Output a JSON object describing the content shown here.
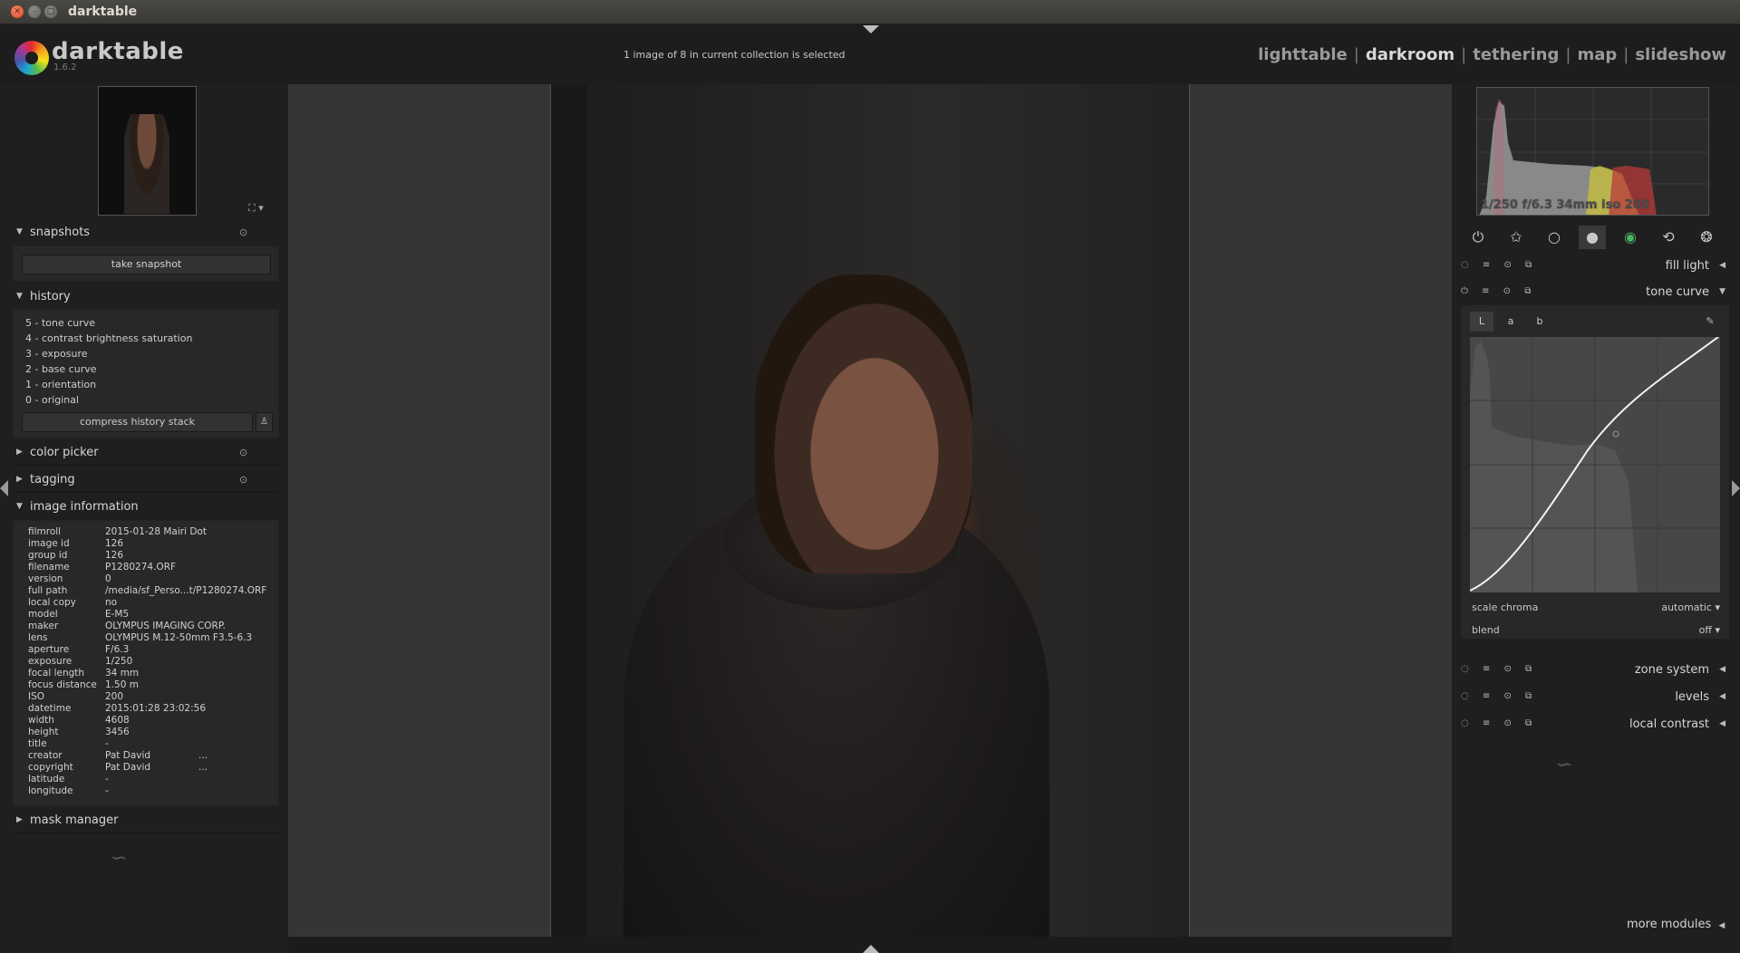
{
  "window": {
    "title": "darktable"
  },
  "app": {
    "name": "darktable",
    "version": "1.6.2"
  },
  "status_text": "1 image of 8 in current collection is selected",
  "views": [
    {
      "label": "lighttable",
      "active": false
    },
    {
      "label": "darkroom",
      "active": true
    },
    {
      "label": "tethering",
      "active": false
    },
    {
      "label": "map",
      "active": false
    },
    {
      "label": "slideshow",
      "active": false
    }
  ],
  "left": {
    "snapshots": {
      "title": "snapshots",
      "button": "take snapshot"
    },
    "history": {
      "title": "history",
      "items": [
        "5 - tone curve",
        "4 - contrast brightness saturation",
        "3 - exposure",
        "2 - base curve",
        "1 - orientation",
        "0 - original"
      ],
      "compress": "compress history stack"
    },
    "color_picker": {
      "title": "color picker"
    },
    "tagging": {
      "title": "tagging"
    },
    "image_information": {
      "title": "image information",
      "rows": [
        {
          "k": "filmroll",
          "v": "2015-01-28 Mairi Dot"
        },
        {
          "k": "image id",
          "v": "126"
        },
        {
          "k": "group id",
          "v": "126"
        },
        {
          "k": "filename",
          "v": "P1280274.ORF"
        },
        {
          "k": "version",
          "v": "0"
        },
        {
          "k": "full path",
          "v": "/media/sf_Perso...t/P1280274.ORF"
        },
        {
          "k": "local copy",
          "v": "no"
        },
        {
          "k": "model",
          "v": "E-M5"
        },
        {
          "k": "maker",
          "v": "OLYMPUS IMAGING CORP."
        },
        {
          "k": "lens",
          "v": "OLYMPUS M.12-50mm F3.5-6.3"
        },
        {
          "k": "aperture",
          "v": "F/6.3"
        },
        {
          "k": "exposure",
          "v": "1/250"
        },
        {
          "k": "focal length",
          "v": "34 mm"
        },
        {
          "k": "focus distance",
          "v": "1.50 m"
        },
        {
          "k": "ISO",
          "v": "200"
        },
        {
          "k": "datetime",
          "v": "2015:01:28 23:02:56"
        },
        {
          "k": "width",
          "v": "4608"
        },
        {
          "k": "height",
          "v": "3456"
        },
        {
          "k": "title",
          "v": "-"
        },
        {
          "k": "creator",
          "v": "Pat David",
          "x": "..."
        },
        {
          "k": "copyright",
          "v": "Pat David",
          "x": "..."
        },
        {
          "k": "latitude",
          "v": "-"
        },
        {
          "k": "longitude",
          "v": "-"
        }
      ]
    },
    "mask_manager": {
      "title": "mask manager"
    }
  },
  "right": {
    "histogram_exif": "1/250 f/6.3 34mm iso 200",
    "module_groups": [
      "power-icon",
      "star-icon",
      "circle-icon",
      "filled-circle-icon",
      "color-icon",
      "correct-icon",
      "effect-icon"
    ],
    "modules": {
      "fill_light": "fill light",
      "tone_curve": "tone curve",
      "zone_system": "zone system",
      "levels": "levels",
      "local_contrast": "local contrast"
    },
    "tone_curve": {
      "tabs": [
        "L",
        "a",
        "b"
      ],
      "scale_chroma_label": "scale chroma",
      "scale_chroma_value": "automatic",
      "blend_label": "blend",
      "blend_value": "off"
    },
    "more_modules": "more modules"
  },
  "colors": {
    "background": "#1b1b1b",
    "panel": "#1f1f1f",
    "canvas": "#353535",
    "text": "#cfcfcf"
  }
}
